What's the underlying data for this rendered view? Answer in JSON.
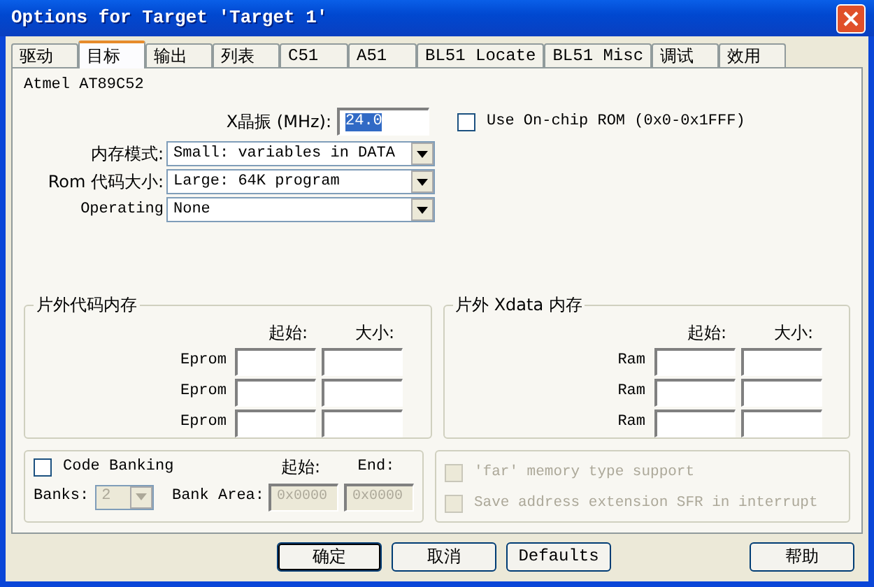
{
  "window": {
    "title": "Options for Target 'Target 1'"
  },
  "tabs": [
    {
      "label": "驱动",
      "selected": false
    },
    {
      "label": "目标",
      "selected": true
    },
    {
      "label": "输出",
      "selected": false
    },
    {
      "label": "列表",
      "selected": false
    },
    {
      "label": "C51",
      "selected": false
    },
    {
      "label": "A51",
      "selected": false
    },
    {
      "label": "BL51 Locate",
      "selected": false
    },
    {
      "label": "BL51 Misc",
      "selected": false
    },
    {
      "label": "调试",
      "selected": false
    },
    {
      "label": "效用",
      "selected": false
    }
  ],
  "device": "Atmel AT89C52",
  "xtal": {
    "label": "X晶振 (MHz):",
    "value": "24.0",
    "highlighted": true
  },
  "onchip_rom": {
    "label": "Use On-chip ROM (0x0-0x1FFF)",
    "checked": false
  },
  "dropdowns": [
    {
      "label": "内存模式:",
      "value": "Small: variables in DATA"
    },
    {
      "label": "Rom 代码大小:",
      "value": "Large: 64K program"
    },
    {
      "label": "Operating",
      "value": "None"
    }
  ],
  "memory_groups": [
    {
      "title": "片外代码内存",
      "columns": [
        "起始:",
        "大小:"
      ],
      "rows": [
        {
          "label": "Eprom"
        },
        {
          "label": "Eprom"
        },
        {
          "label": "Eprom"
        }
      ]
    },
    {
      "title": "片外 Xdata 内存",
      "columns": [
        "起始:",
        "大小:"
      ],
      "rows": [
        {
          "label": "Ram"
        },
        {
          "label": "Ram"
        },
        {
          "label": "Ram"
        }
      ]
    }
  ],
  "code_banking": {
    "label": "Code Banking",
    "checked": false,
    "columns": [
      "起始:",
      "End:"
    ],
    "banks_label": "Banks:",
    "banks_value": "2",
    "area_label": "Bank Area:",
    "start": "0x0000",
    "end": "0x0000",
    "disabled": true
  },
  "options": [
    {
      "label": "'far' memory type support",
      "checked": false,
      "disabled": true
    },
    {
      "label": "Save address extension SFR in interrupt",
      "checked": false,
      "disabled": true
    }
  ],
  "buttons": [
    {
      "label": "确定",
      "default": true
    },
    {
      "label": "取消",
      "default": false
    },
    {
      "label": "Defaults",
      "default": false
    },
    {
      "label": "帮助",
      "default": false
    }
  ]
}
